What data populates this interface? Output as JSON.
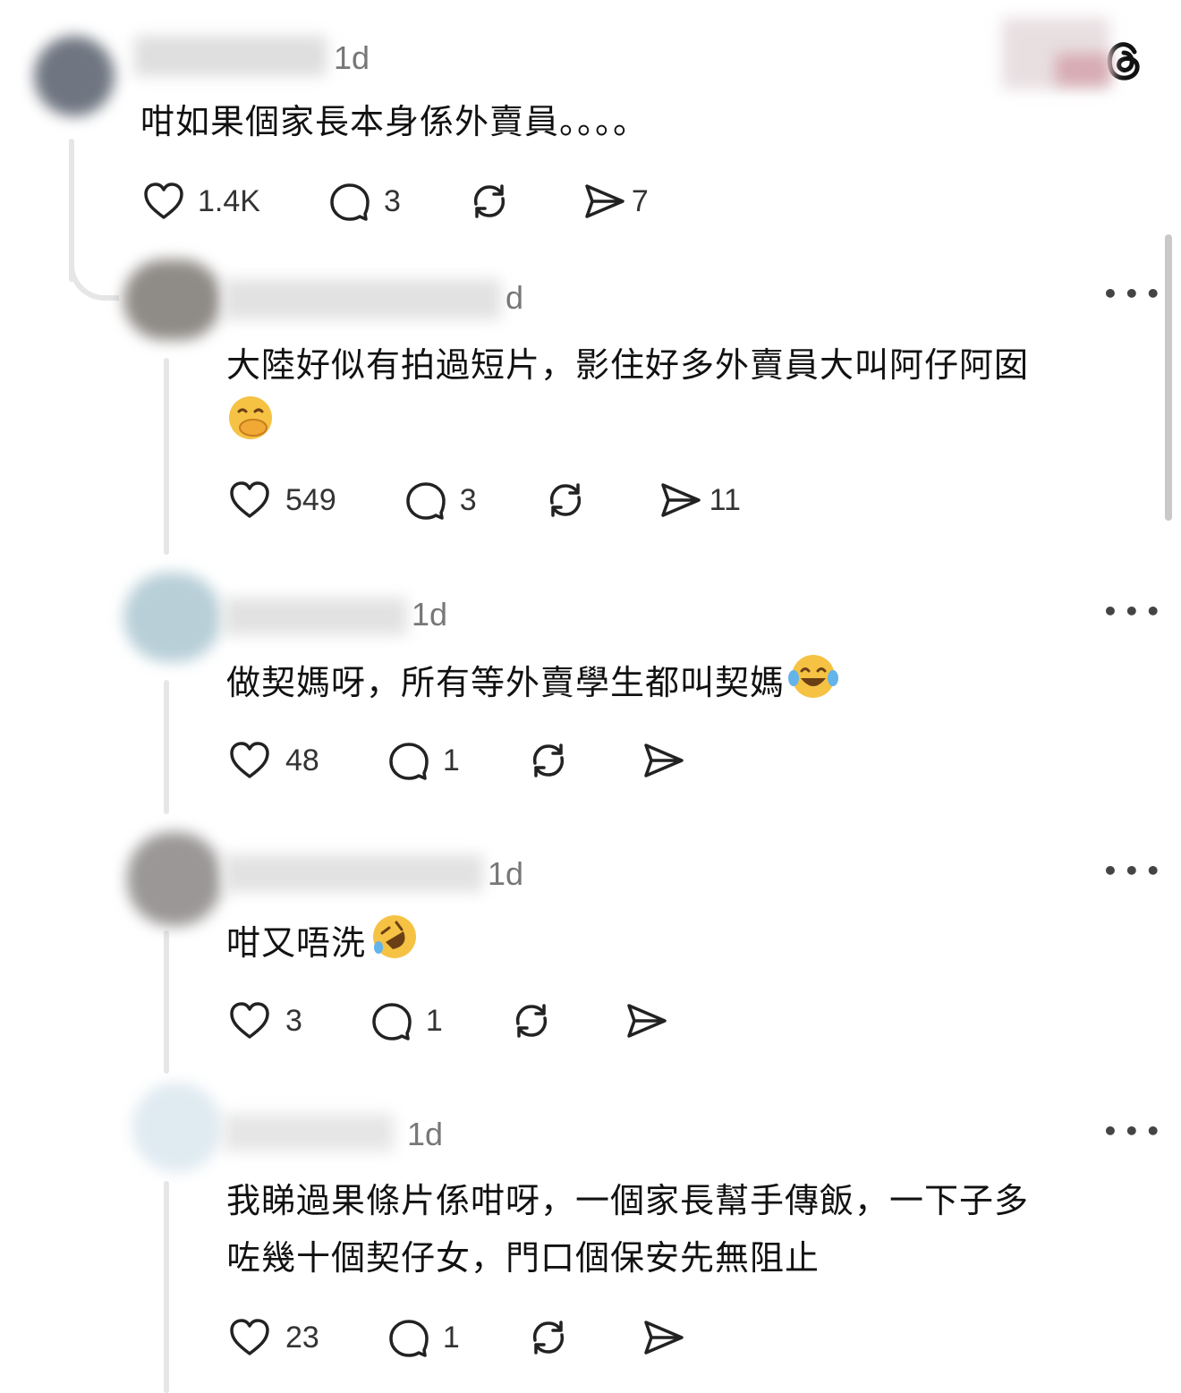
{
  "app": {
    "logo_icon": "threads-logo-icon"
  },
  "main_post": {
    "time": "1d",
    "text": "咁如果個家長本身係外賣員。。。。",
    "likes": "1.4K",
    "replies": "3",
    "shares": "7"
  },
  "replies": [
    {
      "time": "d",
      "line1": "大陸好似有拍過短片，影住好多外賣員大叫阿仔阿囡",
      "emoji": "face-with-hand-over-mouth",
      "likes": "549",
      "replies": "3",
      "shares": "11"
    },
    {
      "time": "1d",
      "line1": "做契媽呀，所有等外賣學生都叫契媽",
      "emoji": "face-with-tears-of-joy",
      "likes": "48",
      "replies": "1",
      "shares": ""
    },
    {
      "time": "1d",
      "line1": "咁又唔洗",
      "emoji": "rolling-on-floor-laughing",
      "likes": "3",
      "replies": "1",
      "shares": ""
    },
    {
      "time": "1d",
      "line1": "我睇過果條片係咁呀，一個家長幫手傳飯，一下子多",
      "line2": "咗幾十個契仔女，門口個保安先無阻止",
      "likes": "23",
      "replies": "1",
      "shares": ""
    }
  ],
  "colors": {
    "text": "#111111",
    "muted": "#777777",
    "thread": "#e6e6e6"
  }
}
